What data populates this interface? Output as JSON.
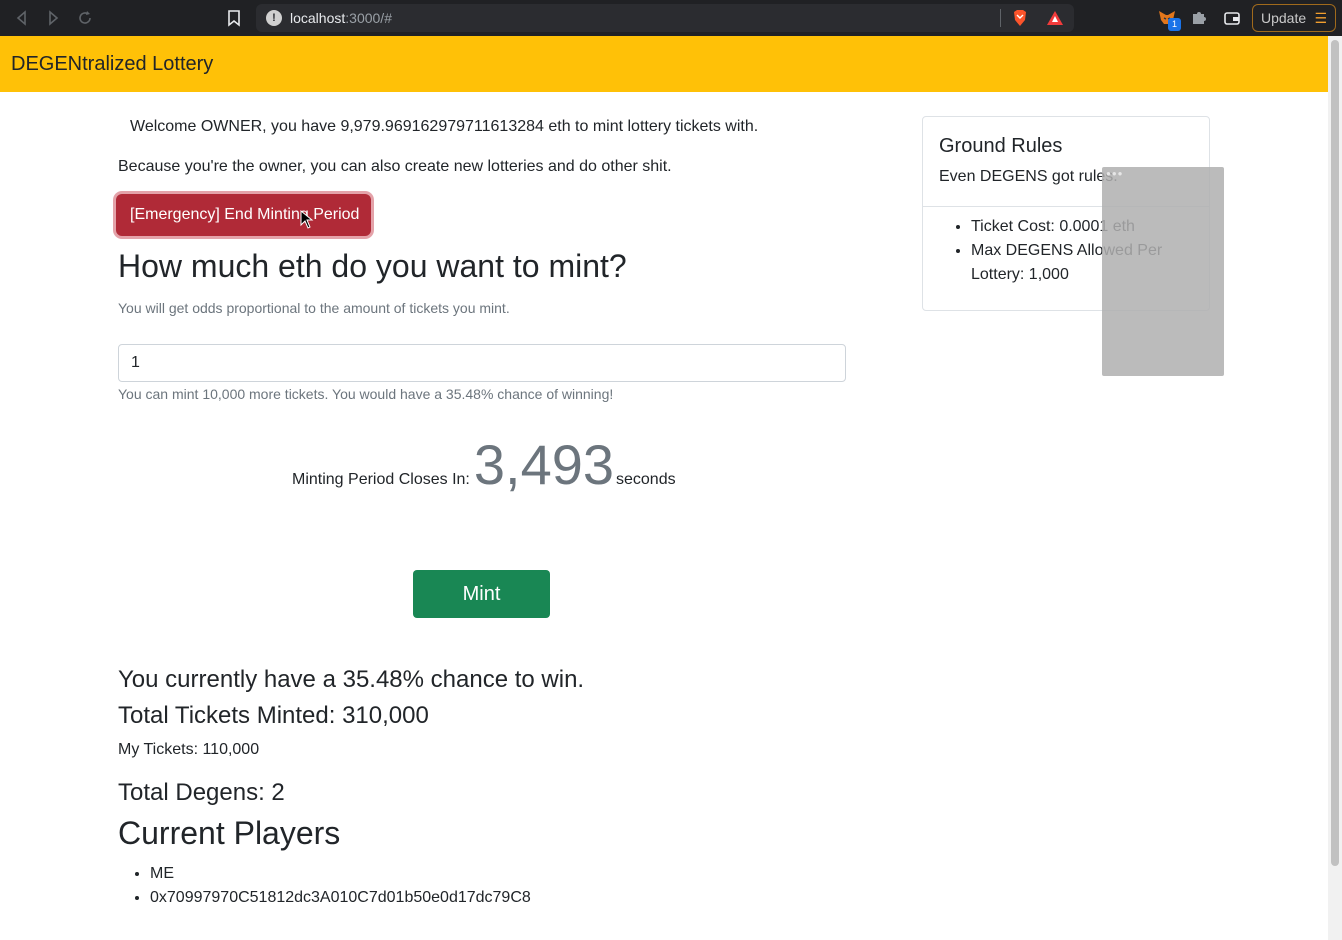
{
  "browser": {
    "url_host": "localhost",
    "url_rest": ":3000/#",
    "extension_badge": "1",
    "update_label": "Update"
  },
  "navbar": {
    "brand": "DEGENtralized Lottery"
  },
  "main": {
    "welcome": "Welcome OWNER, you have 9,979.969162979711613284 eth to mint lottery tickets with.",
    "owner_note": "Because you're the owner, you can also create new lotteries and do other shit.",
    "emergency_button": "[Emergency] End Minting Period",
    "mint_heading": "How much eth do you want to mint?",
    "odds_note": "You will get odds proportional to the amount of tickets you mint.",
    "amount_value": "1",
    "mint_help": "You can mint 10,000 more tickets. You would have a 35.48% chance of winning!",
    "countdown_label": "Minting Period Closes In:",
    "countdown_value": "3,493",
    "countdown_unit": "seconds",
    "mint_button": "Mint",
    "chance": "You currently have a 35.48% chance to win.",
    "total_tickets": "Total Tickets Minted: 310,000",
    "my_tickets": "My Tickets: 110,000",
    "total_degens": "Total Degens: 2",
    "players_title": "Current Players",
    "players": [
      "ME",
      "0x70997970C51812dc3A010C7d01b50e0d17dc79C8"
    ]
  },
  "rules_card": {
    "title": "Ground Rules",
    "subtitle": "Even DEGENS got rules.",
    "rules": [
      "Ticket Cost: 0.0001 eth",
      "Max DEGENS Allowed Per Lottery: 1,000"
    ]
  },
  "colors": {
    "navbar": "#ffc107",
    "danger": "#b02a37",
    "success": "#198754",
    "muted": "#6c757d"
  },
  "icons": [
    "back-icon",
    "forward-icon",
    "reload-icon",
    "bookmark-icon",
    "info-icon",
    "brave-shield-icon",
    "brave-rewards-icon",
    "metamask-fox-icon",
    "puzzle-icon",
    "wallet-icon",
    "menu-icon",
    "cursor-icon"
  ]
}
